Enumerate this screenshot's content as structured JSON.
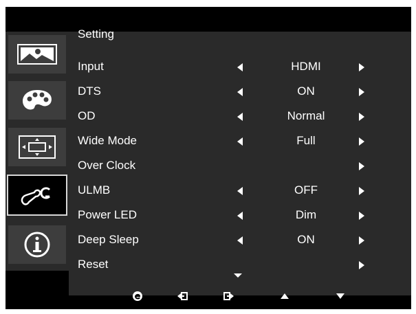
{
  "menu": {
    "title": "Setting",
    "rows": [
      {
        "label": "Input",
        "value": "HDMI",
        "left": true,
        "right": true
      },
      {
        "label": "DTS",
        "value": "ON",
        "left": true,
        "right": true
      },
      {
        "label": "OD",
        "value": "Normal",
        "left": true,
        "right": true
      },
      {
        "label": "Wide Mode",
        "value": "Full",
        "left": true,
        "right": true
      },
      {
        "label": "Over Clock",
        "value": "",
        "left": false,
        "right": true
      },
      {
        "label": "ULMB",
        "value": "OFF",
        "left": true,
        "right": true
      },
      {
        "label": "Power LED",
        "value": "Dim",
        "left": true,
        "right": true
      },
      {
        "label": "Deep Sleep",
        "value": "ON",
        "left": true,
        "right": true
      },
      {
        "label": "Reset",
        "value": "",
        "left": false,
        "right": true
      }
    ]
  },
  "sidebar": {
    "items": [
      {
        "icon": "picture-icon",
        "active": false
      },
      {
        "icon": "palette-icon",
        "active": false
      },
      {
        "icon": "screen-size-icon",
        "active": false
      },
      {
        "icon": "settings-icon",
        "active": true
      },
      {
        "icon": "info-icon",
        "active": false
      }
    ]
  },
  "bottom_bar": {
    "icons": [
      "empowering-icon",
      "back-icon",
      "enter-icon",
      "up-icon",
      "down-icon"
    ]
  }
}
